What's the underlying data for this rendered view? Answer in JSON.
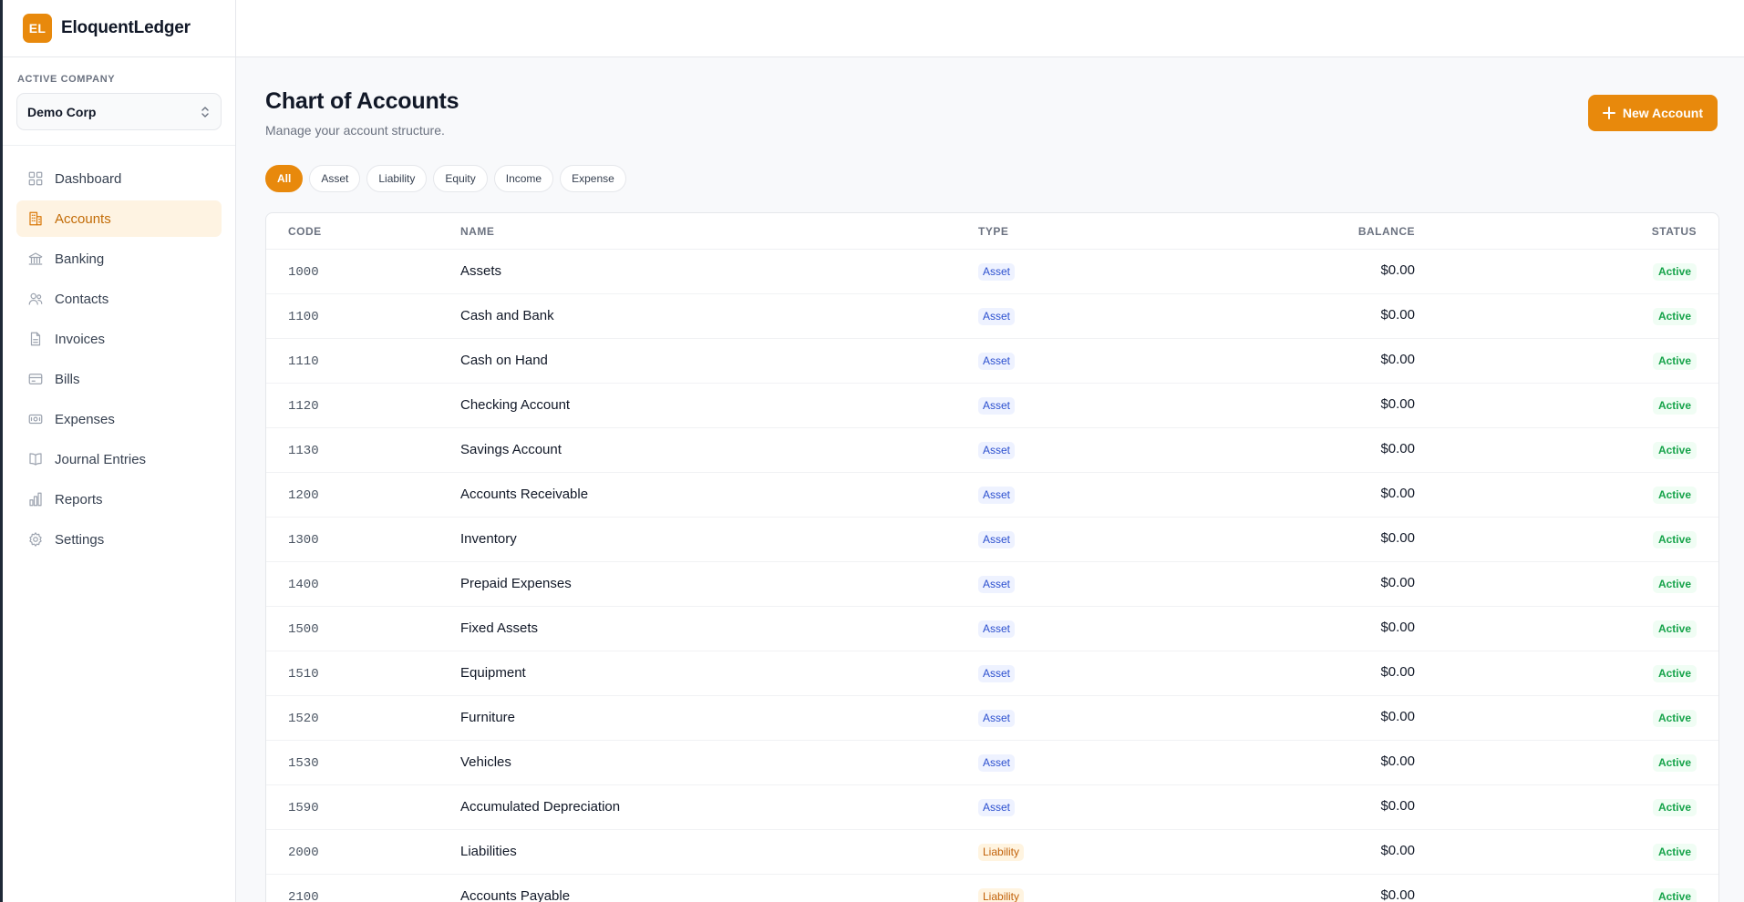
{
  "brand": {
    "logo_text": "EL",
    "name": "EloquentLedger",
    "accent": "#e8890c"
  },
  "company": {
    "label": "ACTIVE COMPANY",
    "selected": "Demo Corp"
  },
  "nav": [
    {
      "label": "Dashboard",
      "icon": "dashboard-icon",
      "active": false
    },
    {
      "label": "Accounts",
      "icon": "building-icon",
      "active": true
    },
    {
      "label": "Banking",
      "icon": "bank-icon",
      "active": false
    },
    {
      "label": "Contacts",
      "icon": "users-icon",
      "active": false
    },
    {
      "label": "Invoices",
      "icon": "file-icon",
      "active": false
    },
    {
      "label": "Bills",
      "icon": "credit-card-icon",
      "active": false
    },
    {
      "label": "Expenses",
      "icon": "banknote-icon",
      "active": false
    },
    {
      "label": "Journal Entries",
      "icon": "book-icon",
      "active": false
    },
    {
      "label": "Reports",
      "icon": "bar-chart-icon",
      "active": false
    },
    {
      "label": "Settings",
      "icon": "gear-icon",
      "active": false
    }
  ],
  "page": {
    "title": "Chart of Accounts",
    "subtitle": "Manage your account structure.",
    "new_button": "New Account"
  },
  "filters": [
    {
      "label": "All",
      "active": true
    },
    {
      "label": "Asset",
      "active": false
    },
    {
      "label": "Liability",
      "active": false
    },
    {
      "label": "Equity",
      "active": false
    },
    {
      "label": "Income",
      "active": false
    },
    {
      "label": "Expense",
      "active": false
    }
  ],
  "table": {
    "headers": {
      "code": "CODE",
      "name": "NAME",
      "type": "TYPE",
      "balance": "BALANCE",
      "status": "STATUS"
    },
    "rows": [
      {
        "code": "1000",
        "name": "Assets",
        "type": "Asset",
        "balance": "$0.00",
        "status": "Active"
      },
      {
        "code": "1100",
        "name": "Cash and Bank",
        "type": "Asset",
        "balance": "$0.00",
        "status": "Active"
      },
      {
        "code": "1110",
        "name": "Cash on Hand",
        "type": "Asset",
        "balance": "$0.00",
        "status": "Active"
      },
      {
        "code": "1120",
        "name": "Checking Account",
        "type": "Asset",
        "balance": "$0.00",
        "status": "Active"
      },
      {
        "code": "1130",
        "name": "Savings Account",
        "type": "Asset",
        "balance": "$0.00",
        "status": "Active"
      },
      {
        "code": "1200",
        "name": "Accounts Receivable",
        "type": "Asset",
        "balance": "$0.00",
        "status": "Active"
      },
      {
        "code": "1300",
        "name": "Inventory",
        "type": "Asset",
        "balance": "$0.00",
        "status": "Active"
      },
      {
        "code": "1400",
        "name": "Prepaid Expenses",
        "type": "Asset",
        "balance": "$0.00",
        "status": "Active"
      },
      {
        "code": "1500",
        "name": "Fixed Assets",
        "type": "Asset",
        "balance": "$0.00",
        "status": "Active"
      },
      {
        "code": "1510",
        "name": "Equipment",
        "type": "Asset",
        "balance": "$0.00",
        "status": "Active"
      },
      {
        "code": "1520",
        "name": "Furniture",
        "type": "Asset",
        "balance": "$0.00",
        "status": "Active"
      },
      {
        "code": "1530",
        "name": "Vehicles",
        "type": "Asset",
        "balance": "$0.00",
        "status": "Active"
      },
      {
        "code": "1590",
        "name": "Accumulated Depreciation",
        "type": "Asset",
        "balance": "$0.00",
        "status": "Active"
      },
      {
        "code": "2000",
        "name": "Liabilities",
        "type": "Liability",
        "balance": "$0.00",
        "status": "Active"
      },
      {
        "code": "2100",
        "name": "Accounts Payable",
        "type": "Liability",
        "balance": "$0.00",
        "status": "Active"
      }
    ]
  }
}
